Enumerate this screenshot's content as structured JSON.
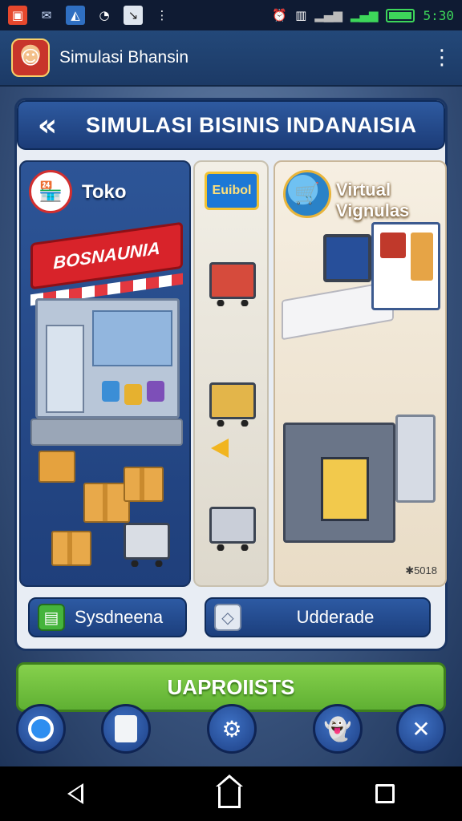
{
  "status_bar": {
    "clock": "5:30",
    "icons": [
      "app-icon",
      "mail-icon",
      "image-icon",
      "sync-icon",
      "edit-icon",
      "more-icon"
    ],
    "right_icons": [
      "alarm-icon",
      "vibrate-icon",
      "signal-icon",
      "wifi-signal-icon",
      "battery-icon"
    ]
  },
  "app_bar": {
    "title": "Simulasi Bhansin"
  },
  "header": {
    "title": "SIMULASI BISINIS INDANAISIA"
  },
  "panels": {
    "toko": {
      "label": "Toko",
      "awning_text": "BOSNAUNIA"
    },
    "middle": {
      "badge_text": "Euibol"
    },
    "virtual": {
      "label_line1": "Virtual",
      "label_line2": "Vignulas",
      "code": "✱5018"
    }
  },
  "actions": {
    "sysdneena": "Sysdneena",
    "udderade": "Udderade"
  },
  "primary_button": {
    "label": "UAPROIISTS"
  },
  "bottom_buttons": [
    "circle-icon",
    "note-icon",
    "settings-icon",
    "ghost-icon",
    "close-icon"
  ],
  "colors": {
    "accent_blue": "#1f3f7b",
    "primary_green": "#5fb033",
    "awning_red": "#d8232a",
    "clock_green": "#3dd65a"
  }
}
